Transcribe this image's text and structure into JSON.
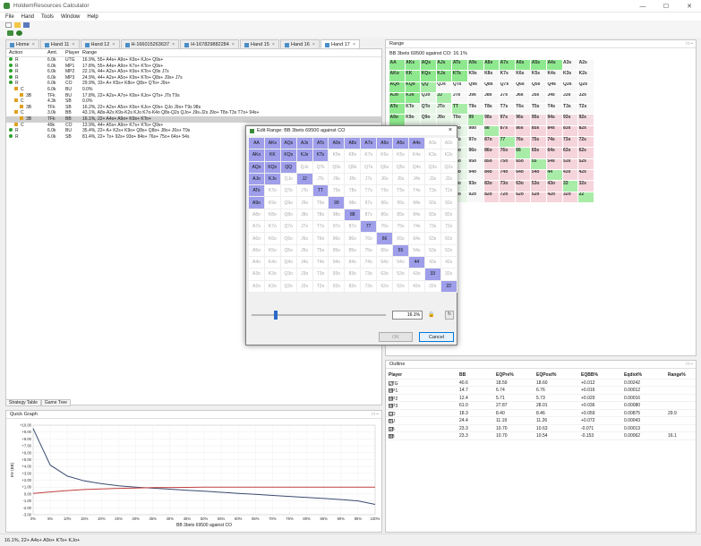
{
  "window": {
    "title": "HoldemResources Calculator"
  },
  "menu": [
    "File",
    "Hand",
    "Tools",
    "Window",
    "Help"
  ],
  "tabs": [
    {
      "label": "Home",
      "active": false
    },
    {
      "label": "Hand 11",
      "active": false
    },
    {
      "label": "Hand 12",
      "active": false
    },
    {
      "label": "H-166015263637",
      "active": false
    },
    {
      "label": "H-167829882284",
      "active": false
    },
    {
      "label": "Hand 15",
      "active": false
    },
    {
      "label": "Hand 16",
      "active": false
    },
    {
      "label": "Hand 17",
      "active": true
    }
  ],
  "strategy": {
    "headers": {
      "action": "Action",
      "amt": "Amt.",
      "player": "Player",
      "range": "Range"
    },
    "rows": [
      {
        "a": "R",
        "amt": "6.0k",
        "p": "UTG",
        "r": "16.9%, 55+ A4s+ A9o+ K9s+ KJo+ Q9s+"
      },
      {
        "a": "R",
        "amt": "6.0k",
        "p": "MP1",
        "r": "17.8%, 55+ A4s+ A9o+ K7s+ KTo+ Q9s+"
      },
      {
        "a": "R",
        "amt": "6.0k",
        "p": "MP2",
        "r": "22.1%, 44+ A2s+ A5o+ K9s+ KTo+ Q9s J7s"
      },
      {
        "a": "R",
        "amt": "6.0k",
        "p": "MP3",
        "r": "24.9%, 44+ A2s+ A5o+ K9s+ KTo+ Q8s+ J9s+ J7s"
      },
      {
        "a": "R",
        "amt": "6.0k",
        "p": "CO",
        "r": "29.9%, 33+ A+ K5s+ K8o+ Q8s+ QTo+ J9s+"
      },
      {
        "a": "C",
        "amt": "6.0k",
        "p": "BU",
        "r": "0.0%"
      },
      {
        "a": "3B",
        "amt": "TFk",
        "p": "BU",
        "r": "17.8%, 22+ A2s+ A7o+ K9s+ KJo+ QTs+ JTs T9s"
      },
      {
        "a": "C",
        "amt": "4.3k",
        "p": "SB",
        "r": "0.0%"
      },
      {
        "a": "3B",
        "amt": "TFk",
        "p": "SB",
        "r": "16.2%, 22+ A2s+ A5o+ K9s+ KJo+ Q9s+ QJo J9s+ T9s 98s"
      },
      {
        "a": "C",
        "amt": "3.0k",
        "p": "BB",
        "r": "43.1%, A8s-A2s K9s-K2s KJo K7o-K4o Q8s-Q2s QJo+ J9s-J2s J9o+ T8s-T3s T7o+ 94s+"
      },
      {
        "a": "3B",
        "amt": "TFk",
        "p": "BB",
        "r": "16.1%, 22+ A4s+ A9o+ K9s+ KTo+"
      },
      {
        "a": "C",
        "amt": "49k",
        "p": "CO",
        "r": "13.9%, 44+ A5s+ A9o+ K7s+ KTo+ Q9s+"
      },
      {
        "a": "R",
        "amt": "6.0k",
        "p": "BU",
        "r": "35.4%, 22+ A+ K2s+ K9o+ Q8s+ Q8o+ J8o+ J6s+ T9s"
      },
      {
        "a": "R",
        "amt": "6.0k",
        "p": "SB",
        "r": "81.4%, 22+ Tx+ 92s+ 93o+ 84s+ 76s+ 75o+ 64s+ 54s"
      }
    ]
  },
  "bottom_tabs": [
    "Strategy Table",
    "Game Tree"
  ],
  "quick_graph": {
    "title": "Quick Graph",
    "chart_data": {
      "type": "line",
      "xlabel": "BB 3bets 69500 against CO",
      "ylabel": "EV (BB)",
      "x_ticks": [
        "0%",
        "5%",
        "10%",
        "15%",
        "20%",
        "25%",
        "30%",
        "35%",
        "40%",
        "45%",
        "50%",
        "55%",
        "60%",
        "65%",
        "70%",
        "75%",
        "80%",
        "85%",
        "90%",
        "95%",
        "100%"
      ],
      "y_ticks": [
        "+10.00",
        "+9.00",
        "+8.00",
        "+7.00",
        "+6.00",
        "+5.00",
        "+4.00",
        "+3.00",
        "+2.00",
        "+1.00",
        "0.00",
        "-1.00",
        "-2.00",
        "-3.00"
      ],
      "ylim": [
        -3,
        10
      ],
      "series": [
        {
          "values": [
            9.5,
            4.2,
            2.6,
            1.9,
            1.5,
            1.2,
            1.0,
            0.85,
            0.7,
            0.55,
            0.4,
            0.25,
            0.1,
            -0.05,
            -0.2,
            -0.35,
            -0.5,
            -0.65,
            -0.8,
            -1.0,
            -1.5
          ]
        },
        {
          "values": [
            0.1,
            0.3,
            0.5,
            0.65,
            0.75,
            0.82,
            0.88,
            0.92,
            0.95,
            0.97,
            0.99,
            1.0,
            1.0,
            1.0,
            1.0,
            1.0,
            1.0,
            1.0,
            1.0,
            1.0,
            1.0
          ]
        }
      ],
      "colors": [
        "#3a4a70",
        "#c04040"
      ]
    }
  },
  "range_panel": {
    "title": "Range",
    "subtitle": "BB 3bets 69500 against CO: 16.1%"
  },
  "dialog": {
    "title": "Edit Range: BB 3bets 69500 against CO",
    "percent": "16.1%",
    "ok": "OK",
    "cancel": "Cancel"
  },
  "outline": {
    "title": "Outline",
    "headers": [
      "Player",
      "BB",
      "EQPre%",
      "EQPost%",
      "EQBB%",
      "Eqdiot%",
      "Range%"
    ],
    "rows": [
      {
        "p": "UTG",
        "checked": false,
        "bb": "40.6",
        "eqpre": "18.59",
        "eqpost": "18.60",
        "eqbb": "+0.012",
        "eqd": "0.00242",
        "range": ""
      },
      {
        "p": "MP1",
        "checked": false,
        "bb": "14.7",
        "eqpre": "6.74",
        "eqpost": "6.76",
        "eqbb": "+0.016",
        "eqd": "0.00012",
        "range": ""
      },
      {
        "p": "MP2",
        "checked": false,
        "bb": "12.4",
        "eqpre": "5.71",
        "eqpost": "5.73",
        "eqbb": "+0.029",
        "eqd": "0.00016",
        "range": ""
      },
      {
        "p": "MP3",
        "checked": false,
        "bb": "61.0",
        "eqpre": "27.87",
        "eqpost": "28.01",
        "eqbb": "+0.036",
        "eqd": "0.00080",
        "range": ""
      },
      {
        "p": "CO",
        "checked": true,
        "bb": "18.3",
        "eqpre": "8.40",
        "eqpost": "8.46",
        "eqbb": "+0.059",
        "eqd": "0.00875",
        "range": "29.9"
      },
      {
        "p": "BU",
        "checked": false,
        "bb": "24.4",
        "eqpre": "11.19",
        "eqpost": "11.26",
        "eqbb": "+0.072",
        "eqd": "0.00043",
        "range": ""
      },
      {
        "p": "SB",
        "checked": false,
        "bb": "23.3",
        "eqpre": "10.70",
        "eqpost": "10.63",
        "eqbb": "-0.071",
        "eqd": "0.00013",
        "range": ""
      },
      {
        "p": "BB",
        "checked": true,
        "bb": "23.3",
        "eqpre": "10.70",
        "eqpost": "10.54",
        "eqbb": "-0.153",
        "eqd": "0.00062",
        "range": "16.1"
      }
    ]
  },
  "statusbar": "16.1%, 22+ A4s+ A9o+ KTs+ KJo+",
  "ranks": [
    "A",
    "K",
    "Q",
    "J",
    "T",
    "9",
    "8",
    "7",
    "6",
    "5",
    "4",
    "3",
    "2"
  ]
}
